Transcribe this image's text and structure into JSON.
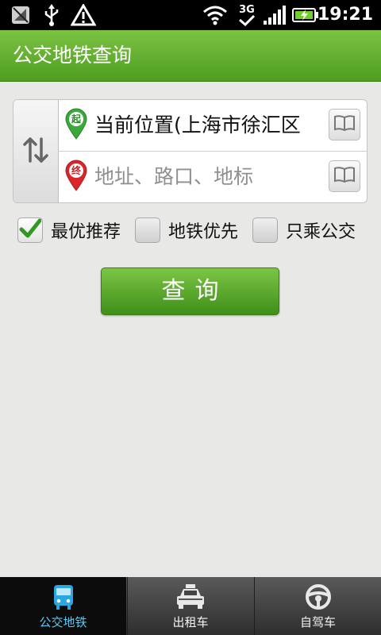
{
  "status_bar": {
    "time": "19:21",
    "network_type": "3G",
    "icons": [
      "signal-off-icon",
      "usb-icon",
      "warning-icon",
      "wifi-icon",
      "3g-icon",
      "signal-bars-icon",
      "battery-charging-icon"
    ]
  },
  "header": {
    "title": "公交地铁查询"
  },
  "route": {
    "start_badge": "起",
    "start_value": "当前位置(上海市徐汇区",
    "end_badge": "终",
    "end_placeholder": "地址、路口、地标"
  },
  "options": [
    {
      "label": "最优推荐",
      "checked": true
    },
    {
      "label": "地铁优先",
      "checked": false
    },
    {
      "label": "只乘公交",
      "checked": false
    }
  ],
  "query_button": "查询",
  "bottom_nav": [
    {
      "label": "公交地铁",
      "icon": "bus-icon",
      "active": true
    },
    {
      "label": "出租车",
      "icon": "taxi-icon",
      "active": false
    },
    {
      "label": "自驾车",
      "icon": "steering-wheel-icon",
      "active": false
    }
  ],
  "colors": {
    "header_green": "#5fae2c",
    "active_tab_text": "#5cc8f2",
    "start_pin": "#3aa83a",
    "end_pin": "#d9262b"
  }
}
